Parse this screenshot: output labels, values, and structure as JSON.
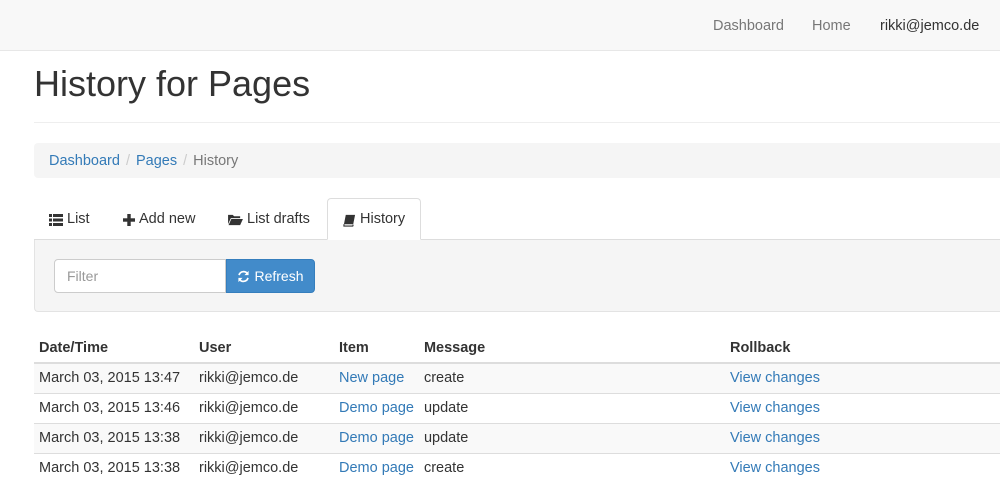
{
  "navbar": {
    "links": [
      {
        "label": "Dashboard"
      },
      {
        "label": "Home"
      }
    ],
    "user": "rikki@jemco.de"
  },
  "page": {
    "title": "History for Pages"
  },
  "breadcrumb": {
    "items": [
      {
        "label": "Dashboard"
      },
      {
        "label": "Pages"
      }
    ],
    "active": "History"
  },
  "tabs": [
    {
      "label": "List",
      "icon": "list-icon"
    },
    {
      "label": "Add new",
      "icon": "plus-icon"
    },
    {
      "label": "List drafts",
      "icon": "folder-open-icon"
    },
    {
      "label": "History",
      "icon": "book-icon",
      "active": true
    }
  ],
  "filter": {
    "placeholder": "Filter",
    "value": "",
    "refresh_label": "Refresh",
    "refresh_icon": "refresh-icon"
  },
  "colors": {
    "link": "#337ab7",
    "primary_button": "#428bca",
    "navbar_bg": "#f8f8f8"
  },
  "table": {
    "headers": {
      "datetime": "Date/Time",
      "user": "User",
      "item": "Item",
      "message": "Message",
      "rollback": "Rollback"
    },
    "rows": [
      {
        "datetime": "March 03, 2015 13:47",
        "user": "rikki@jemco.de",
        "item": "New page",
        "message": "create",
        "rollback": "View changes"
      },
      {
        "datetime": "March 03, 2015 13:46",
        "user": "rikki@jemco.de",
        "item": "Demo page",
        "message": "update",
        "rollback": "View changes"
      },
      {
        "datetime": "March 03, 2015 13:38",
        "user": "rikki@jemco.de",
        "item": "Demo page",
        "message": "update",
        "rollback": "View changes"
      },
      {
        "datetime": "March 03, 2015 13:38",
        "user": "rikki@jemco.de",
        "item": "Demo page",
        "message": "create",
        "rollback": "View changes"
      }
    ]
  }
}
